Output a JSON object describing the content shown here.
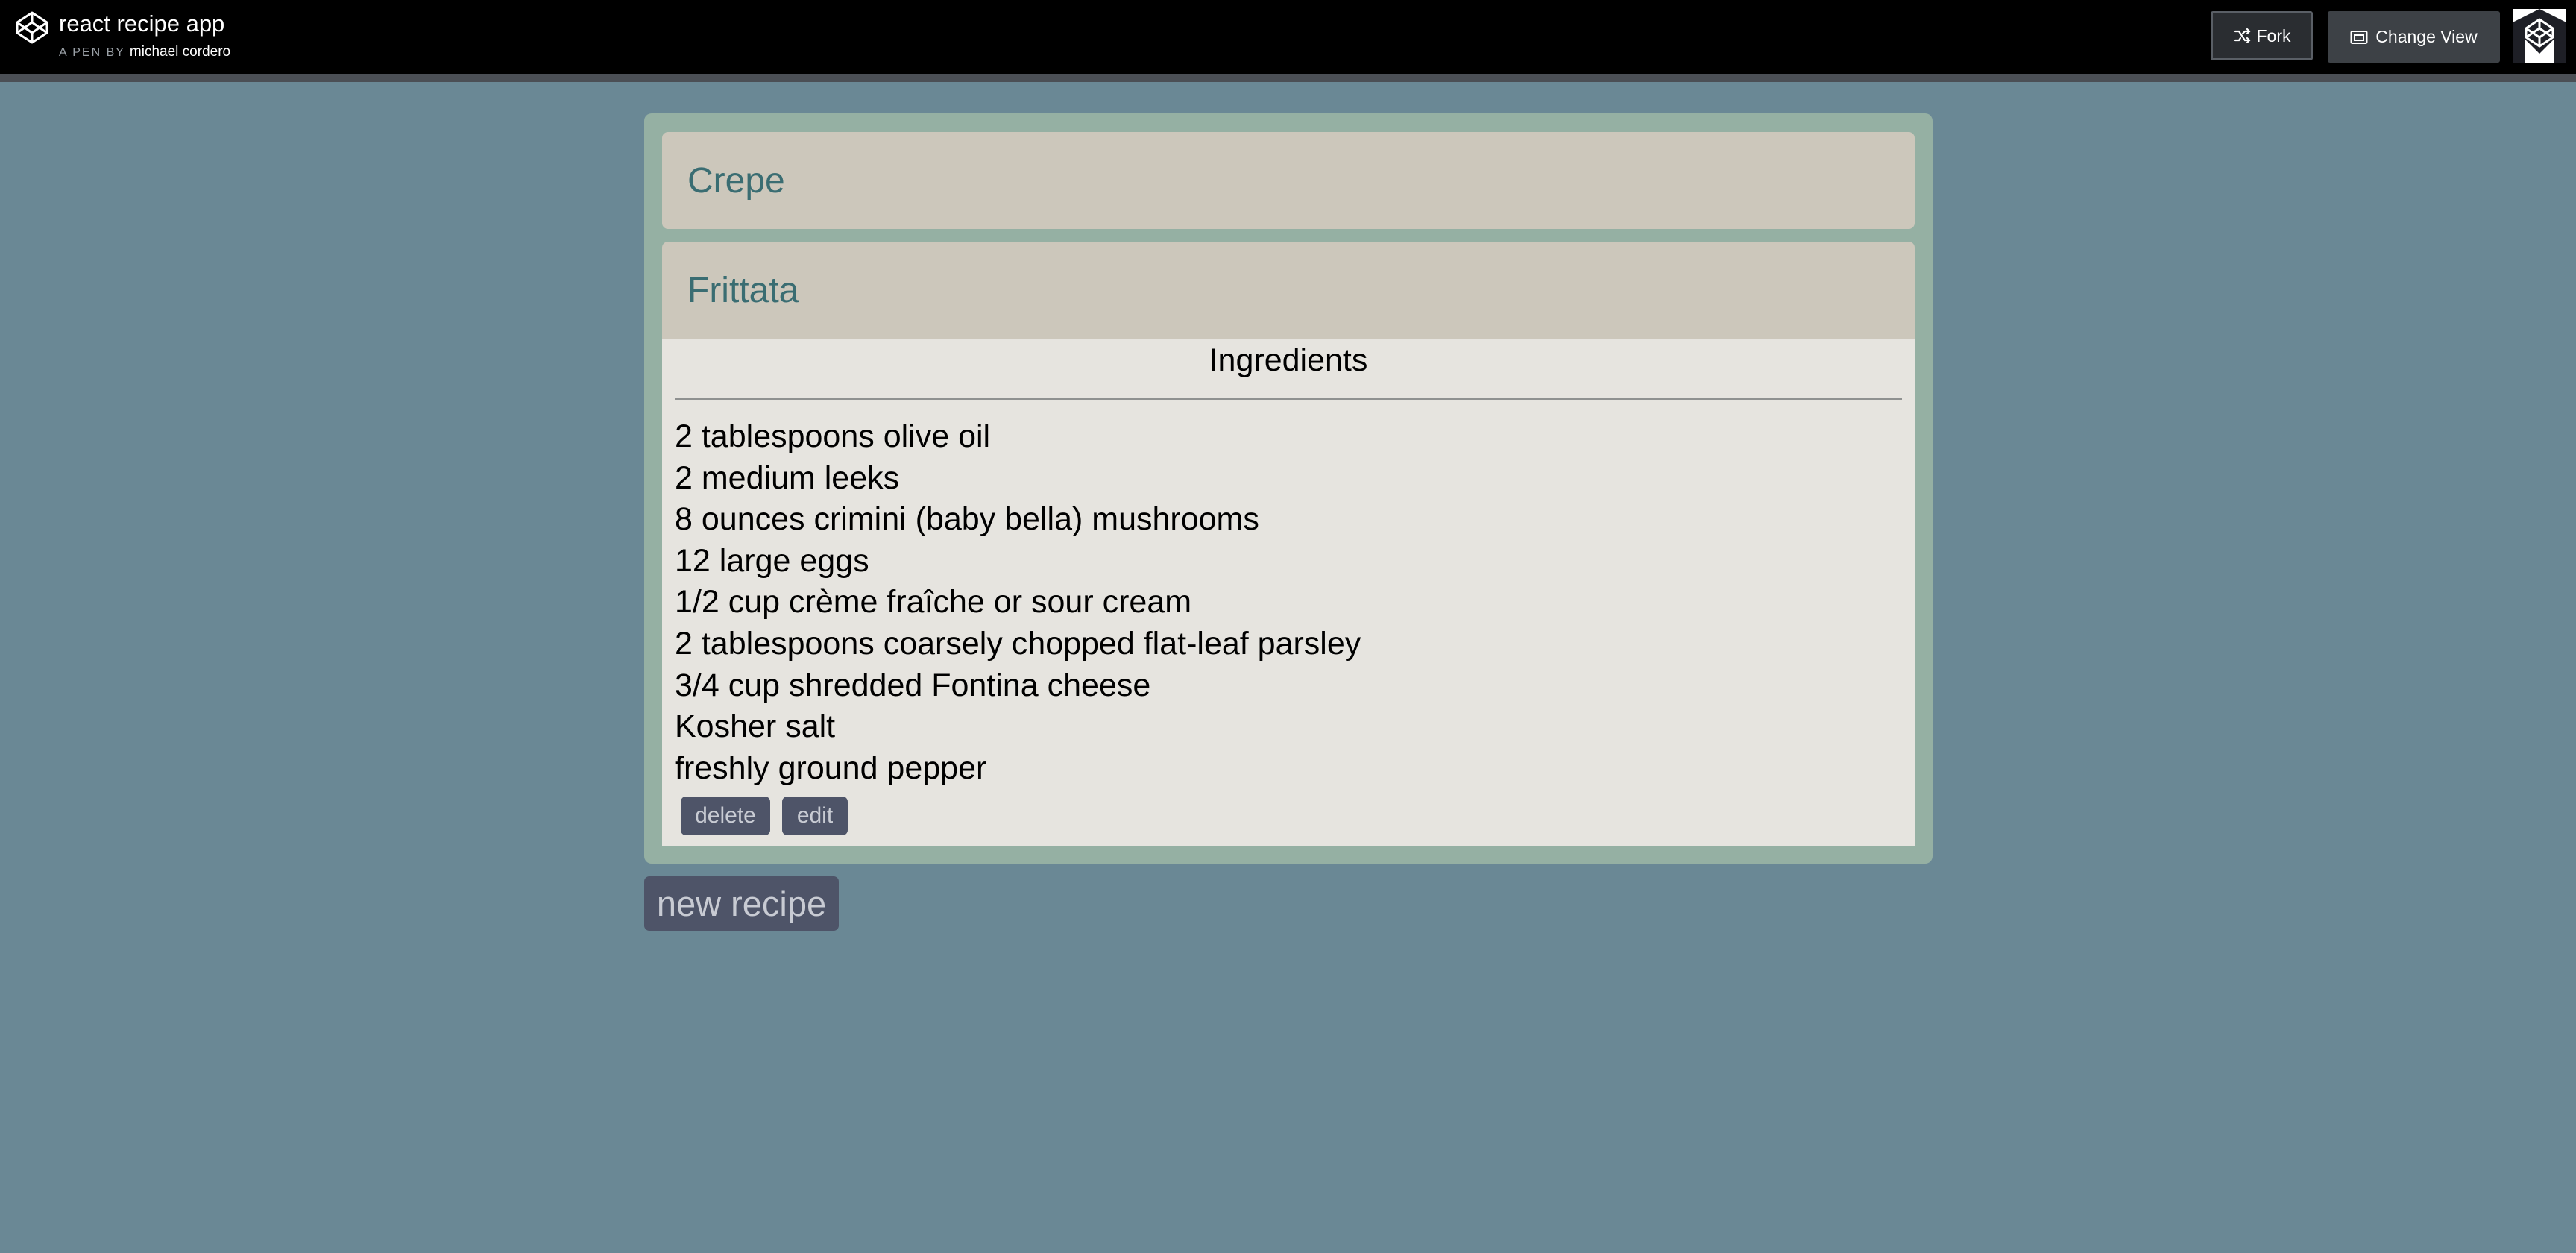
{
  "header": {
    "title": "react recipe app",
    "byline_prefix": "A PEN BY",
    "author": "michael cordero",
    "fork_label": "Fork",
    "change_view_label": "Change View"
  },
  "recipes": [
    {
      "name": "Crepe"
    },
    {
      "name": "Frittata",
      "ingredients_heading": "Ingredients",
      "ingredients": [
        "2 tablespoons olive oil",
        "2 medium leeks",
        "8 ounces crimini (baby bella) mushrooms",
        "12 large eggs",
        "1/2 cup crème fraîche or sour cream",
        "2 tablespoons coarsely chopped flat-leaf parsley",
        "3/4 cup shredded Fontina cheese",
        "Kosher salt",
        "freshly ground pepper"
      ],
      "delete_label": "delete",
      "edit_label": "edit"
    }
  ],
  "new_recipe_label": "new recipe",
  "icons": {
    "logo": "codepen-logo-icon",
    "fork": "fork-icon",
    "change_view": "layout-icon",
    "corner": "codepen-corner-icon"
  },
  "colors": {
    "background": "#6a8895",
    "recipe_box": "#95b0a3",
    "recipe_header": "#ccc7bb",
    "recipe_title": "#3a6d72",
    "recipe_body": "#e6e4df",
    "button": "#4e5468"
  }
}
